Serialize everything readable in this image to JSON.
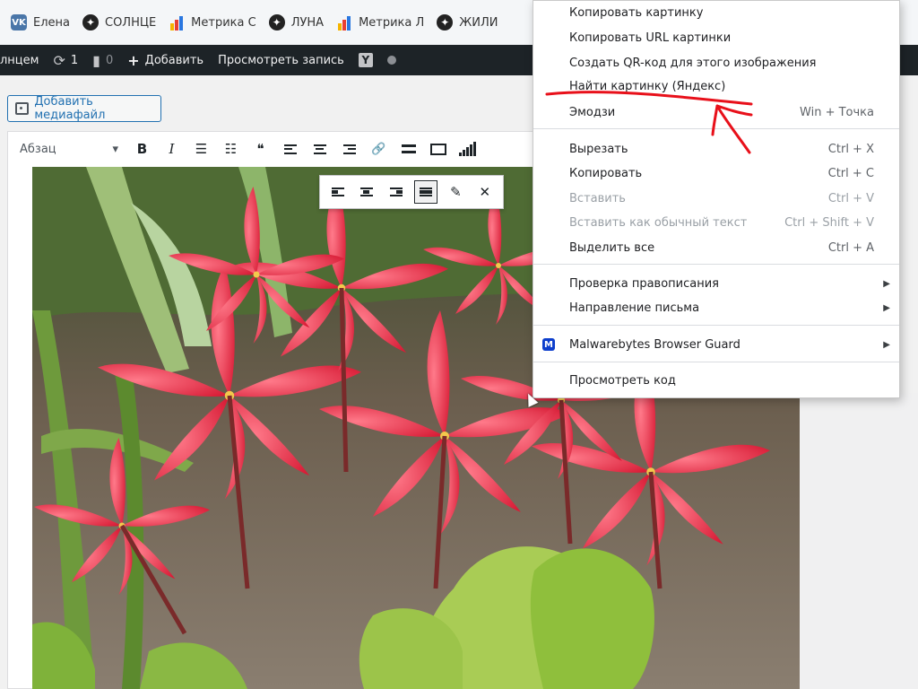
{
  "bookmarks": [
    {
      "label": "Елена",
      "icon": "vk-icon",
      "color": "#4a76a8"
    },
    {
      "label": "СОЛНЦЕ",
      "icon": "compass-star-icon"
    },
    {
      "label": "Метрика С",
      "icon": "metrika-icon"
    },
    {
      "label": "ЛУНА",
      "icon": "compass-star-icon"
    },
    {
      "label": "Метрика Л",
      "icon": "metrika-icon"
    },
    {
      "label": "ЖИЛИ",
      "icon": "compass-star-icon"
    }
  ],
  "adminbar": {
    "site_name": "лнцем",
    "updates_count": "1",
    "comments_count": "0",
    "add_new": "Добавить",
    "view_post": "Просмотреть запись",
    "yoast_letter": "Y"
  },
  "editor": {
    "add_media": "Добавить медиафайл",
    "format_select": "Абзац",
    "bold": "B",
    "italic": "I",
    "quote": "❝",
    "link": "🔗",
    "edit_icon": "✎",
    "remove_icon": "✕"
  },
  "context_menu": {
    "items": [
      {
        "label": "Копировать картинку"
      },
      {
        "label": "Копировать URL картинки"
      },
      {
        "label": "Создать QR-код для этого изображения"
      },
      {
        "label": "Найти картинку (Яндекс)"
      },
      {
        "label": "Эмодзи",
        "shortcut": "Win + Точка"
      },
      {
        "label": "Вырезать",
        "shortcut": "Ctrl + X"
      },
      {
        "label": "Копировать",
        "shortcut": "Ctrl + C"
      },
      {
        "label": "Вставить",
        "shortcut": "Ctrl + V",
        "disabled": true
      },
      {
        "label": "Вставить как обычный текст",
        "shortcut": "Ctrl + Shift + V",
        "disabled": true
      },
      {
        "label": "Выделить все",
        "shortcut": "Ctrl + A"
      },
      {
        "label": "Проверка правописания",
        "submenu": true
      },
      {
        "label": "Направление письма",
        "submenu": true
      },
      {
        "label": "Malwarebytes Browser Guard",
        "submenu": true,
        "icon": "malwarebytes-icon"
      },
      {
        "label": "Просмотреть код"
      }
    ]
  },
  "colors": {
    "admin_bar": "#1d2327",
    "wp_blue": "#2271b1",
    "annotation_red": "#e8101a",
    "flower_red": "#e8243c"
  }
}
